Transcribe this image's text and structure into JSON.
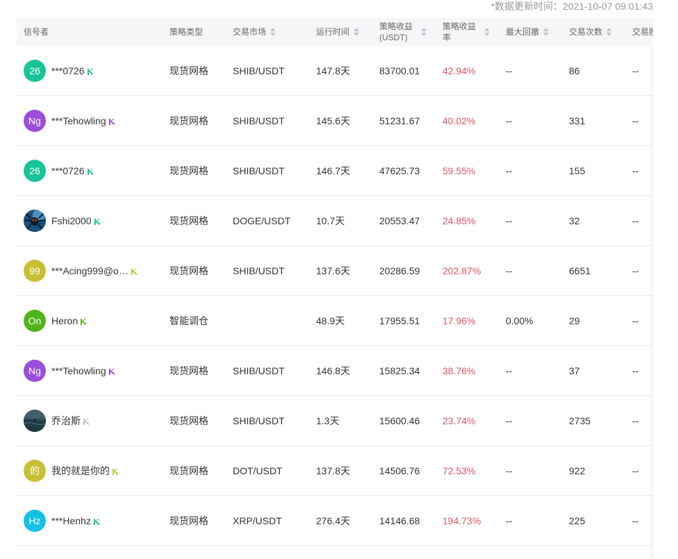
{
  "update_notice": "*数据更新时间：2021-10-07 09:01:43",
  "columns": {
    "signal": "信号者",
    "strategy_type": "策略类型",
    "market": "交易市场",
    "runtime": "运行时间",
    "profit": "策略收益(USDT)",
    "rate": "策略收益率",
    "drawdown": "最大回撤",
    "trades": "交易次数",
    "extra": "交易胜"
  },
  "rows": [
    {
      "avatar_text": "26",
      "avatar_color": "#19c49a",
      "avatar_type": "text",
      "name": "***0726",
      "level_color": "#19c49a",
      "strategy_type": "现货网格",
      "market": "SHIB/USDT",
      "runtime": "147.8天",
      "profit": "83700.01",
      "rate": "42.94%",
      "drawdown": "--",
      "trades": "86",
      "extra": "--"
    },
    {
      "avatar_text": "Ng",
      "avatar_color": "#9b4ddb",
      "avatar_type": "text",
      "name": "***Tehowling",
      "level_color": "#9b4ddb",
      "strategy_type": "现货网格",
      "market": "SHIB/USDT",
      "runtime": "145.6天",
      "profit": "51231.67",
      "rate": "40.02%",
      "drawdown": "--",
      "trades": "331",
      "extra": "--"
    },
    {
      "avatar_text": "26",
      "avatar_color": "#19c49a",
      "avatar_type": "text",
      "name": "***0726",
      "level_color": "#19c49a",
      "strategy_type": "现货网格",
      "market": "SHIB/USDT",
      "runtime": "146.7天",
      "profit": "47625.73",
      "rate": "59.55%",
      "drawdown": "--",
      "trades": "155",
      "extra": "--"
    },
    {
      "avatar_text": "",
      "avatar_color": "#1a4f7a",
      "avatar_type": "photo-spider",
      "name": "Fshi2000",
      "level_color": "#19c49a",
      "strategy_type": "现货网格",
      "market": "DOGE/USDT",
      "runtime": "10.7天",
      "profit": "20553.47",
      "rate": "24.85%",
      "drawdown": "--",
      "trades": "32",
      "extra": "--"
    },
    {
      "avatar_text": "99",
      "avatar_color": "#c9bf35",
      "avatar_type": "text",
      "name": "***Acing999@o…",
      "level_color": "#c9bf35",
      "strategy_type": "现货网格",
      "market": "SHIB/USDT",
      "runtime": "137.6天",
      "profit": "20286.59",
      "rate": "202.87%",
      "drawdown": "--",
      "trades": "6651",
      "extra": "--"
    },
    {
      "avatar_text": "On",
      "avatar_color": "#52b41c",
      "avatar_type": "text",
      "name": "Heron",
      "level_color": "#52b41c",
      "strategy_type": "智能调仓",
      "market": "",
      "runtime": "48.9天",
      "profit": "17955.51",
      "rate": "17.96%",
      "drawdown": "0.00%",
      "trades": "29",
      "extra": "--"
    },
    {
      "avatar_text": "Ng",
      "avatar_color": "#9b4ddb",
      "avatar_type": "text",
      "name": "***Tehowling",
      "level_color": "#9b4ddb",
      "strategy_type": "现货网格",
      "market": "SHIB/USDT",
      "runtime": "146.8天",
      "profit": "15825.34",
      "rate": "38.76%",
      "drawdown": "--",
      "trades": "37",
      "extra": "--"
    },
    {
      "avatar_text": "",
      "avatar_color": "#2c4a55",
      "avatar_type": "photo-sea",
      "name": "乔治斯",
      "level_color": "#c4b8c8",
      "strategy_type": "现货网格",
      "market": "SHIB/USDT",
      "runtime": "1.3天",
      "profit": "15600.46",
      "rate": "23.74%",
      "drawdown": "--",
      "trades": "2735",
      "extra": "--"
    },
    {
      "avatar_text": "的",
      "avatar_color": "#c9bf35",
      "avatar_type": "text",
      "name": "我的就是你的",
      "level_color": "#c9bf35",
      "strategy_type": "现货网格",
      "market": "DOT/USDT",
      "runtime": "137.8天",
      "profit": "14506.76",
      "rate": "72.53%",
      "drawdown": "--",
      "trades": "922",
      "extra": "--"
    },
    {
      "avatar_text": "Hz",
      "avatar_color": "#16c1e6",
      "avatar_type": "text",
      "name": "***Henhz",
      "level_color": "#19c49a",
      "strategy_type": "现货网格",
      "market": "XRP/USDT",
      "runtime": "276.4天",
      "profit": "14146.68",
      "rate": "194.73%",
      "drawdown": "--",
      "trades": "225",
      "extra": "--"
    }
  ]
}
